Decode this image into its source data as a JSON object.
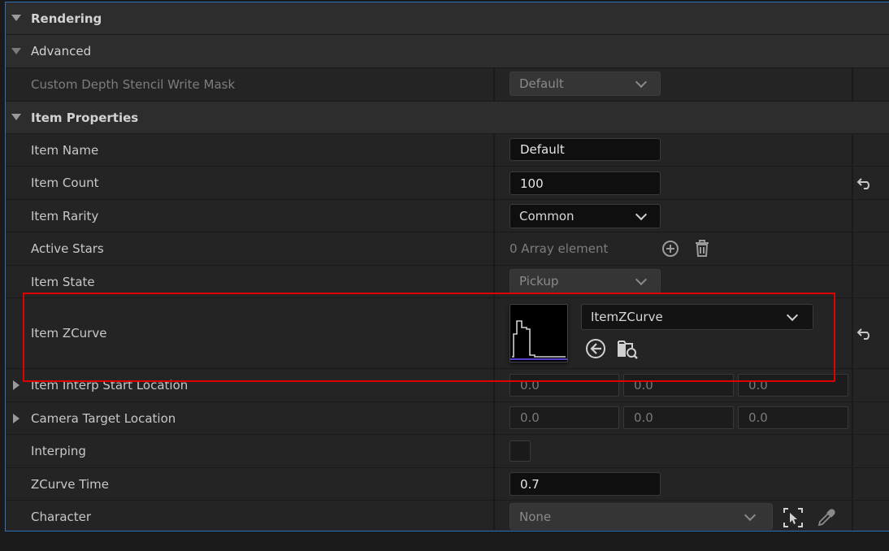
{
  "categories": {
    "rendering": "Rendering",
    "advanced": "Advanced",
    "item_properties": "Item Properties"
  },
  "rows": {
    "custom_depth": {
      "label": "Custom Depth Stencil Write Mask",
      "value": "Default"
    },
    "item_name": {
      "label": "Item Name",
      "value": "Default"
    },
    "item_count": {
      "label": "Item Count",
      "value": "100"
    },
    "item_rarity": {
      "label": "Item Rarity",
      "value": "Common"
    },
    "active_stars": {
      "label": "Active Stars",
      "value": "0 Array element"
    },
    "item_state": {
      "label": "Item State",
      "value": "Pickup"
    },
    "item_zcurve": {
      "label": "Item ZCurve",
      "value": "ItemZCurve"
    },
    "interp_start": {
      "label": "Item Interp Start Location",
      "x": "0.0",
      "y": "0.0",
      "z": "0.0"
    },
    "camera_target": {
      "label": "Camera Target Location",
      "x": "0.0",
      "y": "0.0",
      "z": "0.0"
    },
    "interping": {
      "label": "Interping",
      "checked": false
    },
    "zcurve_time": {
      "label": "ZCurve Time",
      "value": "0.7"
    },
    "character": {
      "label": "Character",
      "value": "None"
    }
  },
  "icons": {
    "reset": "reset-arrow-icon",
    "add": "add-circle-icon",
    "delete": "trash-icon",
    "use_selected": "arrow-left-circle-icon",
    "browse": "folder-search-icon",
    "pick_actor": "select-actor-icon",
    "eyedropper": "eyedropper-icon"
  },
  "colors": {
    "highlight": "#e00000",
    "panel_border": "#2f6fbf"
  }
}
